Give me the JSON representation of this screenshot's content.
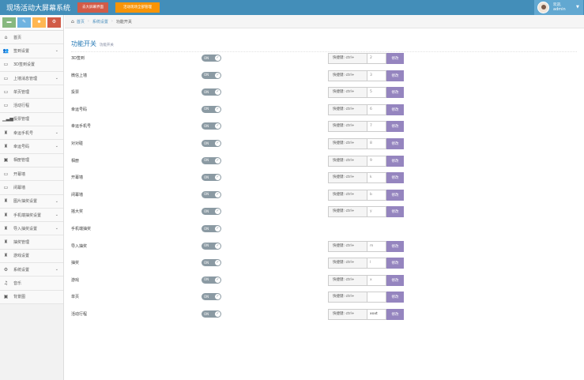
{
  "app": {
    "title": "现场活动大屏幕系统"
  },
  "top_buttons": {
    "btn1": "去大屏幕界面",
    "btn2": "活动现场全部管理"
  },
  "user": {
    "welcome": "欢迎,",
    "name": "admin"
  },
  "breadcrumb": {
    "home": "首页",
    "section": "系统设置",
    "current": "功能开关"
  },
  "page": {
    "title": "功能开关",
    "subtitle": "功能开关"
  },
  "hotkey_prefix": "快捷键: ctrl+",
  "toggle_text": "ON",
  "modify_label": "修改",
  "sidebar": [
    {
      "label": "首页",
      "icon": "dashboard-icon",
      "glyph": "⌂",
      "caret": false
    },
    {
      "label": "签到设置",
      "icon": "users-icon",
      "glyph": "👥",
      "caret": true
    },
    {
      "label": "3D签到设置",
      "icon": "desktop-icon",
      "glyph": "▭",
      "caret": false
    },
    {
      "label": "上墙消息管理",
      "icon": "desktop-icon",
      "glyph": "▭",
      "caret": true
    },
    {
      "label": "单页管理",
      "icon": "desktop-icon",
      "glyph": "▭",
      "caret": false
    },
    {
      "label": "活动行程",
      "icon": "desktop-icon",
      "glyph": "▭",
      "caret": false
    },
    {
      "label": "投票管理",
      "icon": "bar-chart-icon",
      "glyph": "▁▃▅",
      "caret": false
    },
    {
      "label": "幸运手机号",
      "icon": "trophy-icon",
      "glyph": "♜",
      "caret": true
    },
    {
      "label": "幸运号码",
      "icon": "trophy-icon",
      "glyph": "♜",
      "caret": true
    },
    {
      "label": "相册管理",
      "icon": "picture-icon",
      "glyph": "▣",
      "caret": false
    },
    {
      "label": "开幕墙",
      "icon": "desktop-icon",
      "glyph": "▭",
      "caret": false
    },
    {
      "label": "闭幕墙",
      "icon": "desktop-icon",
      "glyph": "▭",
      "caret": false
    },
    {
      "label": "图片抽奖设置",
      "icon": "trophy-icon",
      "glyph": "♜",
      "caret": true
    },
    {
      "label": "手机端抽奖设置",
      "icon": "trophy-icon",
      "glyph": "♜",
      "caret": true
    },
    {
      "label": "导入抽奖设置",
      "icon": "trophy-icon",
      "glyph": "♜",
      "caret": true
    },
    {
      "label": "抽奖管理",
      "icon": "trophy-icon",
      "glyph": "♜",
      "caret": false
    },
    {
      "label": "游戏设置",
      "icon": "trophy-icon",
      "glyph": "♜",
      "caret": false
    },
    {
      "label": "系统设置",
      "icon": "gear-icon",
      "glyph": "⚙",
      "caret": true
    },
    {
      "label": "音乐",
      "icon": "music-icon",
      "glyph": "♫",
      "caret": false
    },
    {
      "label": "背景图",
      "icon": "picture-icon",
      "glyph": "▣",
      "caret": false
    }
  ],
  "features": [
    {
      "label": "3D签到",
      "hotkey": "2",
      "has_hotkey": true
    },
    {
      "label": "微信上墙",
      "hotkey": "3",
      "has_hotkey": true
    },
    {
      "label": "投票",
      "hotkey": "5",
      "has_hotkey": true
    },
    {
      "label": "幸运号码",
      "hotkey": "6",
      "has_hotkey": true
    },
    {
      "label": "幸运手机号",
      "hotkey": "7",
      "has_hotkey": true
    },
    {
      "label": "对对碰",
      "hotkey": "8",
      "has_hotkey": true
    },
    {
      "label": "相册",
      "hotkey": "9",
      "has_hotkey": true
    },
    {
      "label": "开幕墙",
      "hotkey": "k",
      "has_hotkey": true
    },
    {
      "label": "闭幕墙",
      "hotkey": "b",
      "has_hotkey": true
    },
    {
      "label": "摇大奖",
      "hotkey": "y",
      "has_hotkey": true
    },
    {
      "label": "手机端抽奖",
      "hotkey": "",
      "has_hotkey": false
    },
    {
      "label": "导入抽奖",
      "hotkey": "m",
      "has_hotkey": true
    },
    {
      "label": "抽奖",
      "hotkey": "l",
      "has_hotkey": true
    },
    {
      "label": "游戏",
      "hotkey": "x",
      "has_hotkey": true
    },
    {
      "label": "单页",
      "hotkey": "",
      "has_hotkey": true
    },
    {
      "label": "活动行程",
      "hotkey": "xxxt",
      "has_hotkey": true,
      "dark": true
    }
  ]
}
